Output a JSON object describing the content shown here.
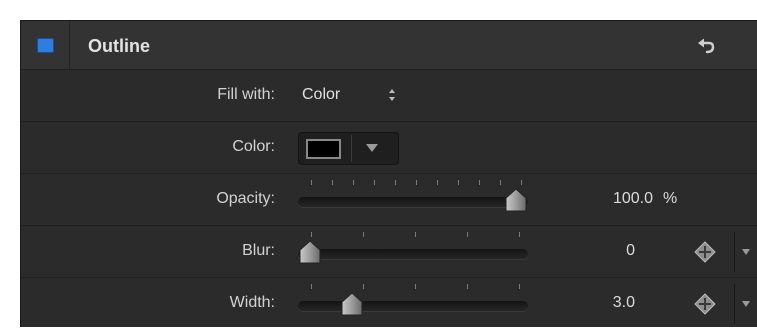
{
  "header": {
    "title": "Outline",
    "checkbox_color": "#2f7de1"
  },
  "rows": {
    "fill_with": {
      "label": "Fill with:",
      "value": "Color"
    },
    "color": {
      "label": "Color:",
      "swatch": "#000000"
    },
    "opacity": {
      "label": "Opacity:",
      "value": "100.0",
      "unit": "%",
      "level": 1.0
    },
    "blur": {
      "label": "Blur:",
      "value": "0",
      "level": 0.0
    },
    "width": {
      "label": "Width:",
      "value": "3.0",
      "level": 0.2
    }
  },
  "icons": {
    "reset": "reset-icon",
    "stepper": "updown-arrows-icon",
    "dropdown": "triangle-down-icon",
    "keyframe": "keyframe-diamond-icon"
  }
}
